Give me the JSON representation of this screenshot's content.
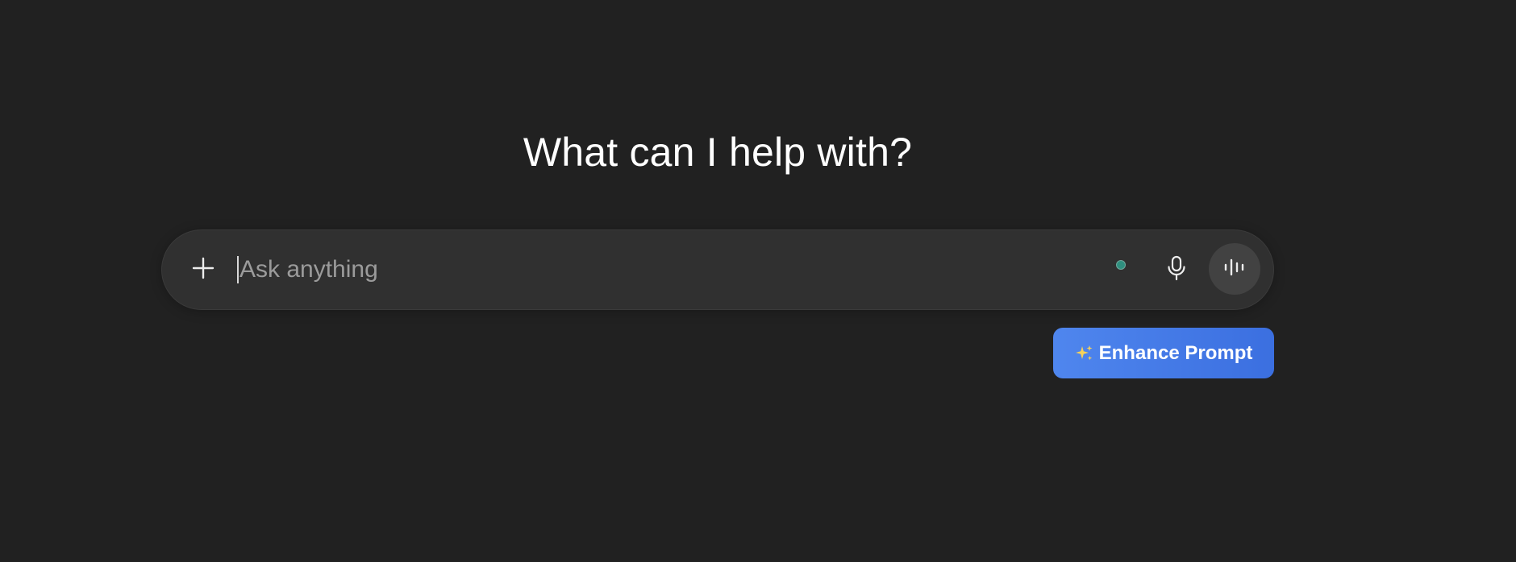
{
  "main": {
    "headline": "What can I help with?"
  },
  "composer": {
    "input_value": "",
    "input_placeholder": "Ask anything",
    "icons": {
      "add": "plus-icon",
      "status": "status-dot-icon",
      "mic": "microphone-icon",
      "voice": "voice-waveform-icon"
    },
    "status_color": "#2f8f7f"
  },
  "enhance": {
    "label": "Enhance Prompt",
    "icon": "sparkles-icon",
    "color": "#3b6fe0"
  }
}
